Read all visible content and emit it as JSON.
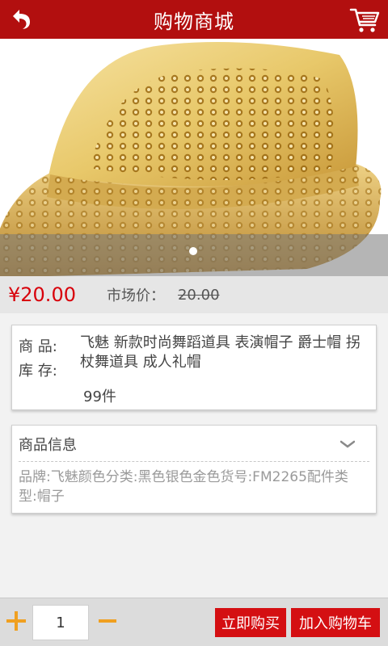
{
  "header": {
    "title": "购物商城",
    "back_icon": "back-arrow-icon",
    "cart_icon": "shopping-cart-icon"
  },
  "hero": {
    "image": "golden sequined fedora hat",
    "carousel_dots": 1,
    "active_dot": 0
  },
  "price": {
    "current": "¥20.00",
    "market_label": "市场价：",
    "market_value": "20.00"
  },
  "product": {
    "name_label": "商 品:",
    "stock_label": "库 存:",
    "name": "飞魅 新款时尚舞蹈道具 表演帽子 爵士帽 拐杖舞道具 成人礼帽",
    "stock": "99件"
  },
  "info": {
    "heading": "商品信息",
    "detail": "品牌:飞魅颜色分类:黑色银色金色货号:FM2265配件类型:帽子"
  },
  "bottom_bar": {
    "quantity": "1",
    "buy_now_label": "立即购买",
    "add_to_cart_label": "加入购物车"
  },
  "colors": {
    "header_red": "#b20f0f",
    "price_red": "#d8000a",
    "button_red": "#d40f12",
    "stepper_orange": "#f0a020"
  }
}
